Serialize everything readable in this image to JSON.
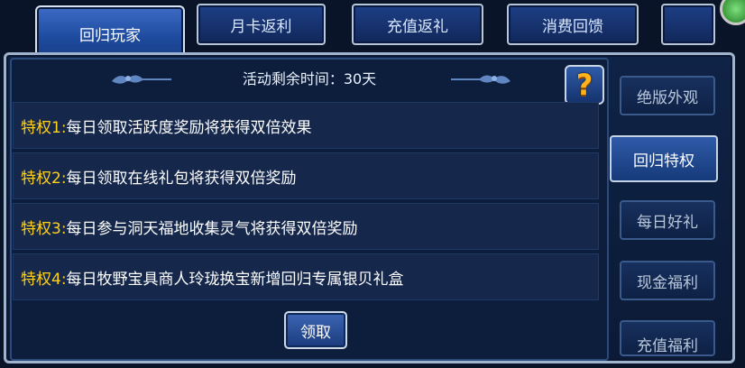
{
  "top_tabs": [
    {
      "label": "回归玩家",
      "active": true
    },
    {
      "label": "月卡返利",
      "active": false
    },
    {
      "label": "充值返礼",
      "active": false
    },
    {
      "label": "消费回馈",
      "active": false
    },
    {
      "label": "",
      "active": false
    }
  ],
  "timer": {
    "text": "活动剩余时间：30天"
  },
  "help": {
    "glyph": "?"
  },
  "privileges": [
    {
      "key": "特权1:",
      "text": "每日领取活跃度奖励将获得双倍效果"
    },
    {
      "key": "特权2:",
      "text": "每日领取在线礼包将获得双倍奖励"
    },
    {
      "key": "特权3:",
      "text": "每日参与洞天福地收集灵气将获得双倍奖励"
    },
    {
      "key": "特权4:",
      "text": "每日牧野宝具商人玲珑换宝新增回归专属银贝礼盒"
    }
  ],
  "claim_button": {
    "label": "领取"
  },
  "side_menu": [
    {
      "label": "绝版外观",
      "active": false
    },
    {
      "label": "回归特权",
      "active": true
    },
    {
      "label": "每日好礼",
      "active": false
    },
    {
      "label": "现金福利",
      "active": false
    },
    {
      "label": "充值福利",
      "active": false
    }
  ],
  "colors": {
    "privilege_key": "#ffd21c",
    "help_icon": "#ffb21a",
    "panel_bg": "#0d1e3d",
    "row_bg": "#15284c"
  }
}
